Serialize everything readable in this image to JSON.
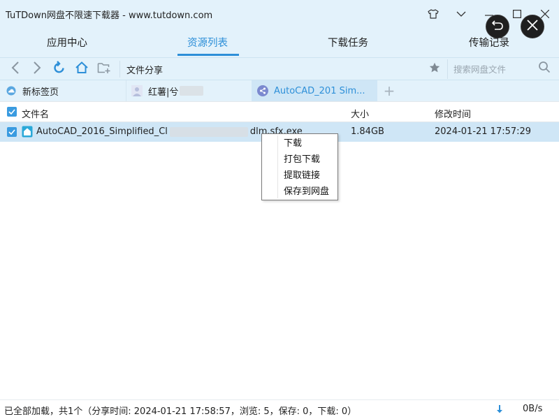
{
  "window": {
    "title": "TuTDown网盘不限速下载器 - www.tutdown.com"
  },
  "main_tabs": [
    {
      "label": "应用中心"
    },
    {
      "label": "资源列表"
    },
    {
      "label": "下载任务"
    },
    {
      "label": "传输记录"
    }
  ],
  "toolbar": {
    "path_label": "文件分享",
    "search_placeholder": "搜索网盘文件"
  },
  "page_tabs": [
    {
      "label": "新标签页"
    },
    {
      "label": "红薯|兮"
    },
    {
      "label": "AutoCAD_201   Sim..."
    }
  ],
  "table": {
    "headers": {
      "name": "文件名",
      "size": "大小",
      "modified": "修改时间"
    },
    "rows": [
      {
        "name_start": "AutoCAD_2016_Simplified_Cl",
        "name_end": "dlm.sfx.exe",
        "size": "1.84GB",
        "modified": "2024-01-21 17:57:29"
      }
    ]
  },
  "context_menu": {
    "items": [
      "下载",
      "打包下载",
      "提取链接",
      "保存到网盘"
    ]
  },
  "status": {
    "text": "已全部加载，共1个（分享时间: 2024-01-21 17:58:57，浏览: 5，保存: 0，下载: 0）",
    "speed": "0B/s"
  },
  "colors": {
    "accent": "#2d8fd8",
    "header_bg": "#e3f2fb",
    "selected_row": "#cfe6f6"
  }
}
